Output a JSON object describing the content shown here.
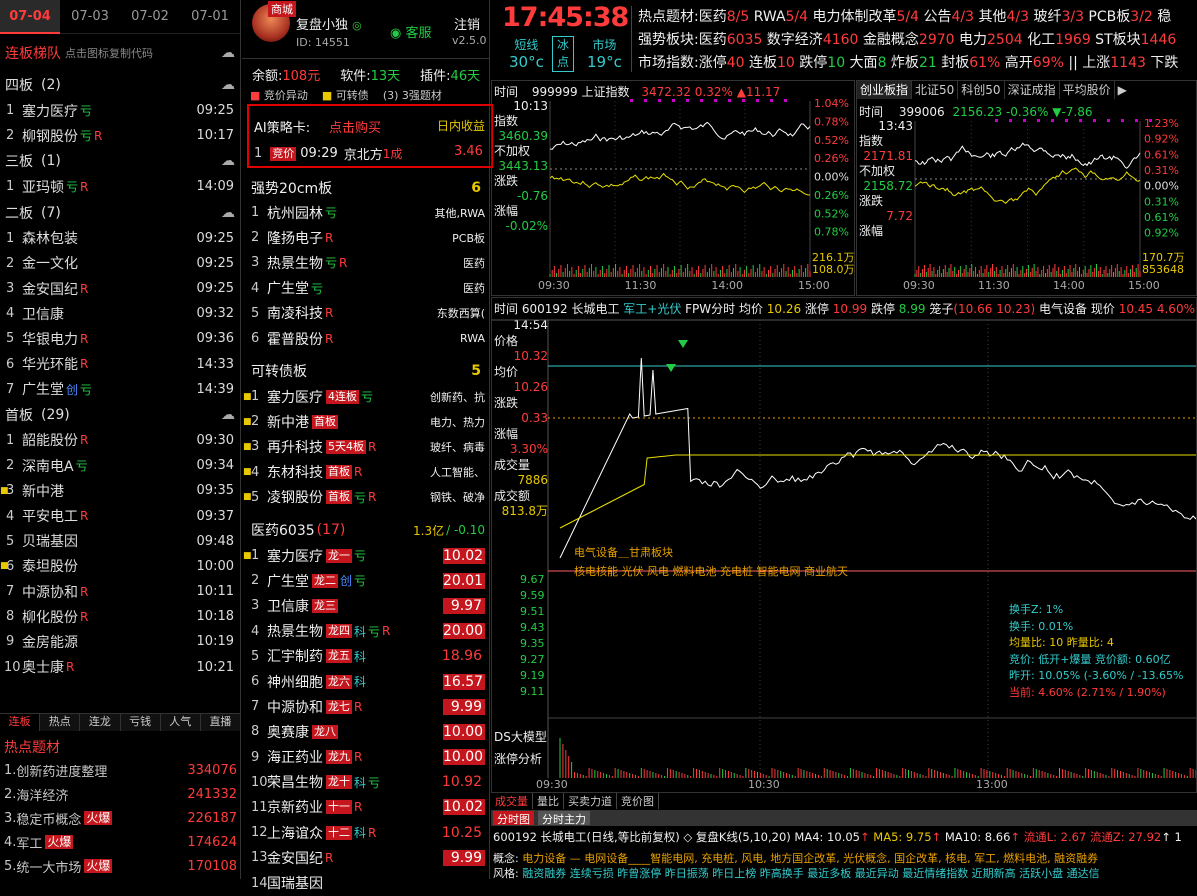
{
  "left": {
    "dates": [
      "07-04",
      "07-03",
      "07-02",
      "07-01"
    ],
    "title": "连板梯队",
    "hint": "点击图标复制代码",
    "groups": [
      {
        "label": "四板",
        "count": "(2)",
        "items": [
          {
            "no": "1",
            "name": "塞力医疗",
            "tags": [
              {
                "t": "亏",
                "c": "grn"
              }
            ],
            "time": "09:25"
          },
          {
            "no": "2",
            "name": "柳钢股份",
            "tags": [
              {
                "t": "亏",
                "c": "grn"
              },
              {
                "t": "R",
                "c": "red"
              }
            ],
            "time": "10:17"
          }
        ]
      },
      {
        "label": "三板",
        "count": "(1)",
        "items": [
          {
            "no": "1",
            "name": "亚玛顿",
            "tags": [
              {
                "t": "亏",
                "c": "grn"
              },
              {
                "t": "R",
                "c": "red"
              }
            ],
            "time": "14:09"
          }
        ]
      },
      {
        "label": "二板",
        "count": "(7)",
        "items": [
          {
            "no": "1",
            "name": "森林包装",
            "tags": [],
            "time": "09:25"
          },
          {
            "no": "2",
            "name": "金一文化",
            "tags": [],
            "time": "09:25"
          },
          {
            "no": "3",
            "name": "金安国纪",
            "tags": [
              {
                "t": "R",
                "c": "red"
              }
            ],
            "time": "09:25"
          },
          {
            "no": "4",
            "name": "卫信康",
            "tags": [],
            "time": "09:32"
          },
          {
            "no": "5",
            "name": "华银电力",
            "tags": [
              {
                "t": "R",
                "c": "red"
              }
            ],
            "time": "09:36"
          },
          {
            "no": "6",
            "name": "华光环能",
            "tags": [
              {
                "t": "R",
                "c": "red"
              }
            ],
            "time": "14:33"
          },
          {
            "no": "7",
            "name": "广生堂",
            "tags": [
              {
                "t": "创",
                "c": "blu"
              },
              {
                "t": "亏",
                "c": "grn"
              }
            ],
            "time": "14:39"
          }
        ]
      },
      {
        "label": "首板",
        "count": "(29)",
        "items": [
          {
            "no": "1",
            "name": "韶能股份",
            "tags": [
              {
                "t": "R",
                "c": "red"
              }
            ],
            "time": "09:30"
          },
          {
            "no": "2",
            "name": "深南电A",
            "tags": [
              {
                "t": "亏",
                "c": "grn"
              }
            ],
            "time": "09:34"
          },
          {
            "no": "3",
            "name": "新中港",
            "tags": [],
            "time": "09:35",
            "dot": true
          },
          {
            "no": "4",
            "name": "平安电工",
            "tags": [
              {
                "t": "R",
                "c": "red"
              }
            ],
            "time": "09:37"
          },
          {
            "no": "5",
            "name": "贝瑞基因",
            "tags": [],
            "time": "09:48"
          },
          {
            "no": "6",
            "name": "泰坦股份",
            "tags": [],
            "time": "10:00",
            "dot": true
          },
          {
            "no": "7",
            "name": "中源协和",
            "tags": [
              {
                "t": "R",
                "c": "red"
              }
            ],
            "time": "10:11"
          },
          {
            "no": "8",
            "name": "柳化股份",
            "tags": [
              {
                "t": "R",
                "c": "red"
              }
            ],
            "time": "10:18"
          },
          {
            "no": "9",
            "name": "金房能源",
            "tags": [],
            "time": "10:19"
          },
          {
            "no": "10",
            "name": "奥士康",
            "tags": [
              {
                "t": "R",
                "c": "red"
              }
            ],
            "time": "10:21"
          }
        ]
      }
    ],
    "bottom_tabs": [
      "连板",
      "热点",
      "连龙",
      "亏钱",
      "人气",
      "直播"
    ],
    "hot_title": "热点题材",
    "hot": [
      {
        "no": "1.",
        "name": "创新药进度整理",
        "fire": "",
        "val": "334076"
      },
      {
        "no": "2.",
        "name": "海洋经济",
        "fire": "",
        "val": "241332"
      },
      {
        "no": "3.",
        "name": "稳定币概念",
        "fire": "火爆",
        "val": "226187"
      },
      {
        "no": "4.",
        "name": "军工",
        "fire": "火爆",
        "val": "174624"
      },
      {
        "no": "5.",
        "name": "统一大市场",
        "fire": "火爆",
        "val": "170108"
      }
    ]
  },
  "mid": {
    "shop": "商城",
    "user": "复盘小独",
    "id": "ID: 14551",
    "service": "客服",
    "logout": "注销",
    "version": "v2.5.0",
    "balance_label": "余额:",
    "balance": "108元",
    "soft_label": "软件:",
    "soft": "13天",
    "plugin_label": "插件:",
    "plugin": "46天",
    "chk1": "竞价异动",
    "chk2": "可转债",
    "chk3": "(3) 3强题材",
    "ai_label": "AI策略卡:",
    "ai_buy": "点击购买",
    "ai_profit": "日内收益",
    "ai_row": {
      "no": "1",
      "tag": "竞价",
      "time": "09:29",
      "name": "京北方",
      "extra": "1成",
      "val": "3.46"
    },
    "s1": {
      "title": "强势20cm板",
      "count": "6",
      "rows": [
        {
          "no": "1",
          "name": "杭州园林",
          "tags": [
            {
              "t": "亏",
              "c": "grn"
            }
          ],
          "ind": "其他,RWA"
        },
        {
          "no": "2",
          "name": "隆扬电子",
          "tags": [
            {
              "t": "R",
              "c": "red"
            }
          ],
          "ind": "PCB板"
        },
        {
          "no": "3",
          "name": "热景生物",
          "tags": [
            {
              "t": "亏",
              "c": "grn"
            },
            {
              "t": "R",
              "c": "red"
            }
          ],
          "ind": "医药"
        },
        {
          "no": "4",
          "name": "广生堂",
          "tags": [
            {
              "t": "亏",
              "c": "grn"
            }
          ],
          "ind": "医药"
        },
        {
          "no": "5",
          "name": "南凌科技",
          "tags": [
            {
              "t": "R",
              "c": "red"
            }
          ],
          "ind": "东数西算("
        },
        {
          "no": "6",
          "name": "霍普股份",
          "tags": [
            {
              "t": "R",
              "c": "red"
            }
          ],
          "ind": "RWA"
        }
      ]
    },
    "s2": {
      "title": "可转债板",
      "count": "5",
      "rows": [
        {
          "no": "1",
          "name": "塞力医疗",
          "badge": "4连板",
          "tags": [
            {
              "t": "亏",
              "c": "grn"
            }
          ],
          "ind": "创新药、抗"
        },
        {
          "no": "2",
          "name": "新中港",
          "badge": "首板",
          "tags": [],
          "ind": "电力、热力"
        },
        {
          "no": "3",
          "name": "再升科技",
          "badge": "5天4板",
          "tags": [
            {
              "t": "R",
              "c": "red"
            }
          ],
          "ind": "玻纤、病毒"
        },
        {
          "no": "4",
          "name": "东材科技",
          "badge": "首板",
          "tags": [
            {
              "t": "R",
              "c": "red"
            }
          ],
          "ind": "人工智能、"
        },
        {
          "no": "5",
          "name": "凌钢股份",
          "badge": "首板",
          "tags": [
            {
              "t": "亏",
              "c": "grn"
            },
            {
              "t": "R",
              "c": "red"
            }
          ],
          "ind": "钢铁、破净"
        }
      ]
    },
    "s3": {
      "title": "医药6035",
      "count": "(17)",
      "amt": "1.3亿",
      "chg": "/ -0.10",
      "rows": [
        {
          "no": "1",
          "name": "塞力医疗",
          "badge": "龙一",
          "tags": [
            {
              "t": "亏",
              "c": "grn"
            }
          ],
          "val": "10.02",
          "box": true,
          "dot": true
        },
        {
          "no": "2",
          "name": "广生堂",
          "badge": "龙二",
          "tags": [
            {
              "t": "创",
              "c": "blu"
            },
            {
              "t": "亏",
              "c": "grn"
            }
          ],
          "val": "20.01",
          "box": true
        },
        {
          "no": "3",
          "name": "卫信康",
          "badge": "龙三",
          "tags": [],
          "val": "9.97",
          "box": true
        },
        {
          "no": "4",
          "name": "热景生物",
          "badge": "龙四",
          "tags": [
            {
              "t": "科",
              "c": "cyan"
            },
            {
              "t": "亏",
              "c": "grn"
            },
            {
              "t": "R",
              "c": "red"
            }
          ],
          "val": "20.00",
          "box": true
        },
        {
          "no": "5",
          "name": "汇宇制药",
          "badge": "龙五",
          "tags": [
            {
              "t": "科",
              "c": "cyan"
            }
          ],
          "val": "18.96",
          "box": false
        },
        {
          "no": "6",
          "name": "神州细胞",
          "badge": "龙六",
          "tags": [
            {
              "t": "科",
              "c": "cyan"
            }
          ],
          "val": "16.57",
          "box": true
        },
        {
          "no": "7",
          "name": "中源协和",
          "badge": "龙七",
          "tags": [
            {
              "t": "R",
              "c": "red"
            }
          ],
          "val": "9.99",
          "box": true
        },
        {
          "no": "8",
          "name": "奥赛康",
          "badge": "龙八",
          "tags": [],
          "val": "10.00",
          "box": true
        },
        {
          "no": "9",
          "name": "海正药业",
          "badge": "龙九",
          "tags": [
            {
              "t": "R",
              "c": "red"
            }
          ],
          "val": "10.00",
          "box": true
        },
        {
          "no": "10",
          "name": "荣昌生物",
          "badge": "龙十",
          "tags": [
            {
              "t": "科",
              "c": "cyan"
            },
            {
              "t": "亏",
              "c": "grn"
            }
          ],
          "val": "10.92",
          "box": false
        },
        {
          "no": "11",
          "name": "京新药业",
          "badge": "十一",
          "tags": [
            {
              "t": "R",
              "c": "red"
            }
          ],
          "val": "10.02",
          "box": true
        },
        {
          "no": "12",
          "name": "上海谊众",
          "badge": "十二",
          "tags": [
            {
              "t": "科",
              "c": "cyan"
            },
            {
              "t": "R",
              "c": "red"
            }
          ],
          "val": "10.25",
          "box": false
        },
        {
          "no": "13",
          "name": "金安国纪",
          "badge": "",
          "tags": [
            {
              "t": "R",
              "c": "red"
            }
          ],
          "val": "9.99",
          "box": true
        },
        {
          "no": "14",
          "name": "国瑞基因",
          "badge": "",
          "tags": [],
          "val": "",
          "box": false
        }
      ]
    }
  },
  "top": {
    "clock": "17:45:38",
    "w1l": "短线",
    "w1v": "30°c",
    "ice1": "冰",
    "ice2": "点",
    "w2l": "市场",
    "w2v": "19°c",
    "rows": [
      [
        {
          "t": "热点题材:",
          "c": "wht"
        },
        {
          "t": "医药",
          "c": "wht"
        },
        {
          "t": "8/5",
          "c": "red"
        },
        {
          "t": " RWA",
          "c": "wht"
        },
        {
          "t": "5/4",
          "c": "red"
        },
        {
          "t": " 电力体制改革",
          "c": "wht"
        },
        {
          "t": "5/4",
          "c": "red"
        },
        {
          "t": " 公告",
          "c": "wht"
        },
        {
          "t": "4/3",
          "c": "red"
        },
        {
          "t": " 其他",
          "c": "wht"
        },
        {
          "t": "4/3",
          "c": "red"
        },
        {
          "t": " 玻纤",
          "c": "wht"
        },
        {
          "t": "3/3",
          "c": "red"
        },
        {
          "t": " PCB板",
          "c": "wht"
        },
        {
          "t": "3/2",
          "c": "red"
        },
        {
          "t": " 稳",
          "c": "wht"
        }
      ],
      [
        {
          "t": "强势板块:",
          "c": "wht"
        },
        {
          "t": "医药",
          "c": "wht"
        },
        {
          "t": "6035",
          "c": "red"
        },
        {
          "t": " 数字经济",
          "c": "wht"
        },
        {
          "t": "4160",
          "c": "red"
        },
        {
          "t": " 金融概念",
          "c": "wht"
        },
        {
          "t": "2970",
          "c": "red"
        },
        {
          "t": " 电力",
          "c": "wht"
        },
        {
          "t": "2504",
          "c": "red"
        },
        {
          "t": " 化工",
          "c": "wht"
        },
        {
          "t": "1969",
          "c": "red"
        },
        {
          "t": " ST板块",
          "c": "wht"
        },
        {
          "t": "1446",
          "c": "red"
        }
      ],
      [
        {
          "t": "市场指数:",
          "c": "wht"
        },
        {
          "t": "涨停",
          "c": "wht"
        },
        {
          "t": "40",
          "c": "red"
        },
        {
          "t": " 连板",
          "c": "wht"
        },
        {
          "t": "10",
          "c": "red"
        },
        {
          "t": " 跌停",
          "c": "wht"
        },
        {
          "t": "10",
          "c": "grn"
        },
        {
          "t": " 大面",
          "c": "wht"
        },
        {
          "t": "8",
          "c": "grn"
        },
        {
          "t": " 炸板",
          "c": "wht"
        },
        {
          "t": "21",
          "c": "grn"
        },
        {
          "t": " 封板",
          "c": "wht"
        },
        {
          "t": "61%",
          "c": "red"
        },
        {
          "t": " 高开",
          "c": "wht"
        },
        {
          "t": "69%",
          "c": "red"
        },
        {
          "t": " || 上涨",
          "c": "wht"
        },
        {
          "t": "1143",
          "c": "red"
        },
        {
          "t": " 下跌",
          "c": "wht"
        }
      ]
    ]
  },
  "sh": {
    "time_lbl": "时间",
    "time": "10:13",
    "code": "999999",
    "name": "上证指数",
    "price": "3472.32",
    "pct": "0.32%",
    "chg": "▲11.17",
    "idx_lbl": "指数",
    "idx": "3460.39",
    "nfq": "不加权",
    "nfqv": "3443.13",
    "zd": "涨跌",
    "zdv": "-0.76",
    "zf": "涨幅",
    "zfv": "-0.02%",
    "pl": [
      "1.04%",
      "0.78%",
      "0.52%",
      "0.26%",
      "0.00%",
      "0.26%",
      "0.52%",
      "0.78%"
    ],
    "vol1": "216.1万",
    "vol2": "108.0万",
    "xt": [
      "09:30",
      "11:30",
      "14:00",
      "15:00"
    ]
  },
  "cy": {
    "tabs": [
      "创业板指",
      "北证50",
      "科创50",
      "深证成指",
      "平均股价"
    ],
    "time_lbl": "时间",
    "time": "13:43",
    "code": "399006",
    "price": "2156.23",
    "pct": "-0.36%",
    "chg": "▼-7.86",
    "idx_lbl": "指数",
    "idx": "2171.81",
    "nfq": "不加权",
    "nfqv": "2158.72",
    "zd": "涨跌",
    "zdv": "7.72",
    "zf": "涨幅",
    "pl": [
      "1.23%",
      "0.92%",
      "0.61%",
      "0.31%",
      "0.00%",
      "0.31%",
      "0.61%",
      "0.92%"
    ],
    "vol1": "170.7万",
    "vol2": "853648",
    "xt": [
      "09:30",
      "11:30",
      "14:00",
      "15:00"
    ]
  },
  "main": {
    "hdr": [
      {
        "t": "时间",
        "c": "wht"
      },
      {
        "t": "  600192 长城电工  ",
        "c": "wht"
      },
      {
        "t": "军工+光伏",
        "c": "cyan"
      },
      {
        "t": "  FPW分时  均价 ",
        "c": "wht"
      },
      {
        "t": "10.26",
        "c": "yel"
      },
      {
        "t": "  涨停 ",
        "c": "wht"
      },
      {
        "t": "10.99",
        "c": "red"
      },
      {
        "t": "  跌停 ",
        "c": "wht"
      },
      {
        "t": "8.99",
        "c": "grn"
      },
      {
        "t": "  笼子",
        "c": "wht"
      },
      {
        "t": "(10.66 10.23)",
        "c": "red"
      },
      {
        "t": "  电气设备  现价 ",
        "c": "wht"
      },
      {
        "t": "10.45",
        "c": "red"
      },
      {
        "t": "  4.60%",
        "c": "red"
      }
    ],
    "time": "14:54",
    "price_lbl": "价格",
    "price": "10.32",
    "avg_lbl": "均价",
    "avg": "10.26",
    "zd_lbl": "涨跌",
    "zd": "0.33",
    "zf_lbl": "涨幅",
    "zf": "3.30%",
    "vol_lbl": "成交量",
    "vol": "7886",
    "amt_lbl": "成交额",
    "amt": "813.8万",
    "ax": [
      "9.67",
      "9.59",
      "9.51",
      "9.43",
      "9.35",
      "9.27",
      "9.19",
      "9.11"
    ],
    "ann1": "电气设备＿甘肃板块",
    "ann2": "核电核能 光伏 风电 燃料电池 充电桩 智能电网 商业航天",
    "info": [
      {
        "t": "换手Z: 1%",
        "c": "cyan"
      },
      {
        "t": "换手: 0.01%",
        "c": "cyan"
      },
      {
        "t": "均量比: 10        昨量比: 4",
        "c": "yel"
      },
      {
        "t": "竞价: 低开+爆量 竞价额: 0.60亿",
        "c": "cyan"
      },
      {
        "t": "昨开: 10.05% (-3.60% / -13.65%",
        "c": "cyan"
      },
      {
        "t": "当前: 4.60% (2.71% / 1.90%)",
        "c": "red"
      }
    ],
    "ds": "DS大模型",
    "zt": "涨停分析",
    "xt": [
      "09:30",
      "10:30",
      "13:00"
    ]
  },
  "bottom": {
    "tabs": [
      "成交量",
      "量比",
      "买卖力道",
      "竞价图"
    ],
    "tabs2": [
      "分时图",
      "分时主力"
    ],
    "kline": [
      {
        "t": "600192 长城电工(日线,等比前复权)",
        "c": "wht"
      },
      {
        "t": "  ◇ 复盘K线(5,10,20)  ",
        "c": "wht"
      },
      {
        "t": "MA4: 10.05",
        "c": "wht"
      },
      {
        "t": "↑  ",
        "c": "red"
      },
      {
        "t": "MA5: 9.75",
        "c": "yel"
      },
      {
        "t": "↑  ",
        "c": "red"
      },
      {
        "t": "MA10: 8.66",
        "c": "wht"
      },
      {
        "t": "↑  ",
        "c": "red"
      },
      {
        "t": "流通L: 2.67  流通Z: 27.92",
        "c": "red"
      },
      {
        "t": "↑ 1",
        "c": "wht"
      }
    ],
    "concept_lbl": "概念:",
    "concept": "电力设备 — 电网设备____智能电网, 充电桩, 风电, 地方国企改革, 光伏概念, 国企改革, 核电, 军工, 燃料电池, 融资融券",
    "style_lbl": "风格:",
    "style": "融资融券 连续亏损 昨曾涨停 昨日振荡 昨日上榜 昨高换手 最近多板 最近异动 最近情绪指数 近期新高 活跃小盘 通达信"
  },
  "colors": {
    "red": "#ff3b3b",
    "green": "#22cc44",
    "yellow": "#e8c800",
    "cyan": "#33cccc",
    "accent_box": "#e00000"
  }
}
